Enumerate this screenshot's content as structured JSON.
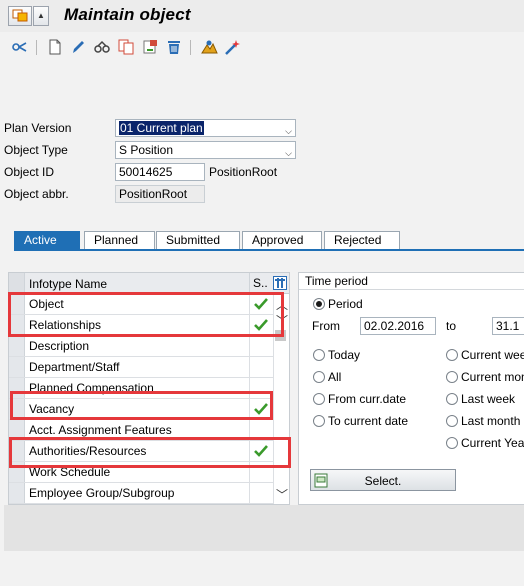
{
  "window": {
    "title": "Maintain object"
  },
  "toolbar": {
    "icons": [
      "display-icon",
      "create-icon",
      "change-icon",
      "overview-icon",
      "copy-icon",
      "delimit-icon",
      "delete-icon",
      "structure-icon",
      "wizard-icon"
    ]
  },
  "form": {
    "plan_version": {
      "label": "Plan Version",
      "value": "01 Current plan"
    },
    "object_type": {
      "label": "Object Type",
      "value": "S Position"
    },
    "object_id": {
      "label": "Object ID",
      "value": "50014625",
      "text": "PositionRoot"
    },
    "object_abbr": {
      "label": "Object abbr.",
      "value": "PositionRoot"
    }
  },
  "tabs": [
    {
      "label": "Active",
      "active": true
    },
    {
      "label": "Planned",
      "active": false
    },
    {
      "label": "Submitted",
      "active": false
    },
    {
      "label": "Approved",
      "active": false
    },
    {
      "label": "Rejected",
      "active": false
    }
  ],
  "infotypes": {
    "col_name": "Infotype Name",
    "col_status": "S..",
    "rows": [
      {
        "name": "Object",
        "check": true,
        "highlight": true
      },
      {
        "name": "Relationships",
        "check": true,
        "highlight": true
      },
      {
        "name": "Description",
        "check": false,
        "highlight": false
      },
      {
        "name": "Department/Staff",
        "check": false,
        "highlight": false
      },
      {
        "name": "Planned Compensation",
        "check": false,
        "highlight": false
      },
      {
        "name": "Vacancy",
        "check": true,
        "highlight": true
      },
      {
        "name": "Acct. Assignment Features",
        "check": false,
        "highlight": false
      },
      {
        "name": "Authorities/Resources",
        "check": true,
        "highlight": true
      },
      {
        "name": "Work Schedule",
        "check": false,
        "highlight": false
      },
      {
        "name": "Employee Group/Subgroup",
        "check": false,
        "highlight": false
      }
    ]
  },
  "time_period": {
    "title": "Time period",
    "period_label": "Period",
    "from_label": "From",
    "from_value": "02.02.2016",
    "to_label": "to",
    "to_value": "31.1",
    "left_options": [
      "Today",
      "All",
      "From curr.date",
      "To current date"
    ],
    "right_options": [
      "Current wee",
      "Current mon",
      "Last week",
      "Last month",
      "Current Yea"
    ],
    "select_button": "Select."
  },
  "colors": {
    "accent": "#1f6fb5",
    "highlight": "#e5383b",
    "check": "#3a9a2b"
  }
}
